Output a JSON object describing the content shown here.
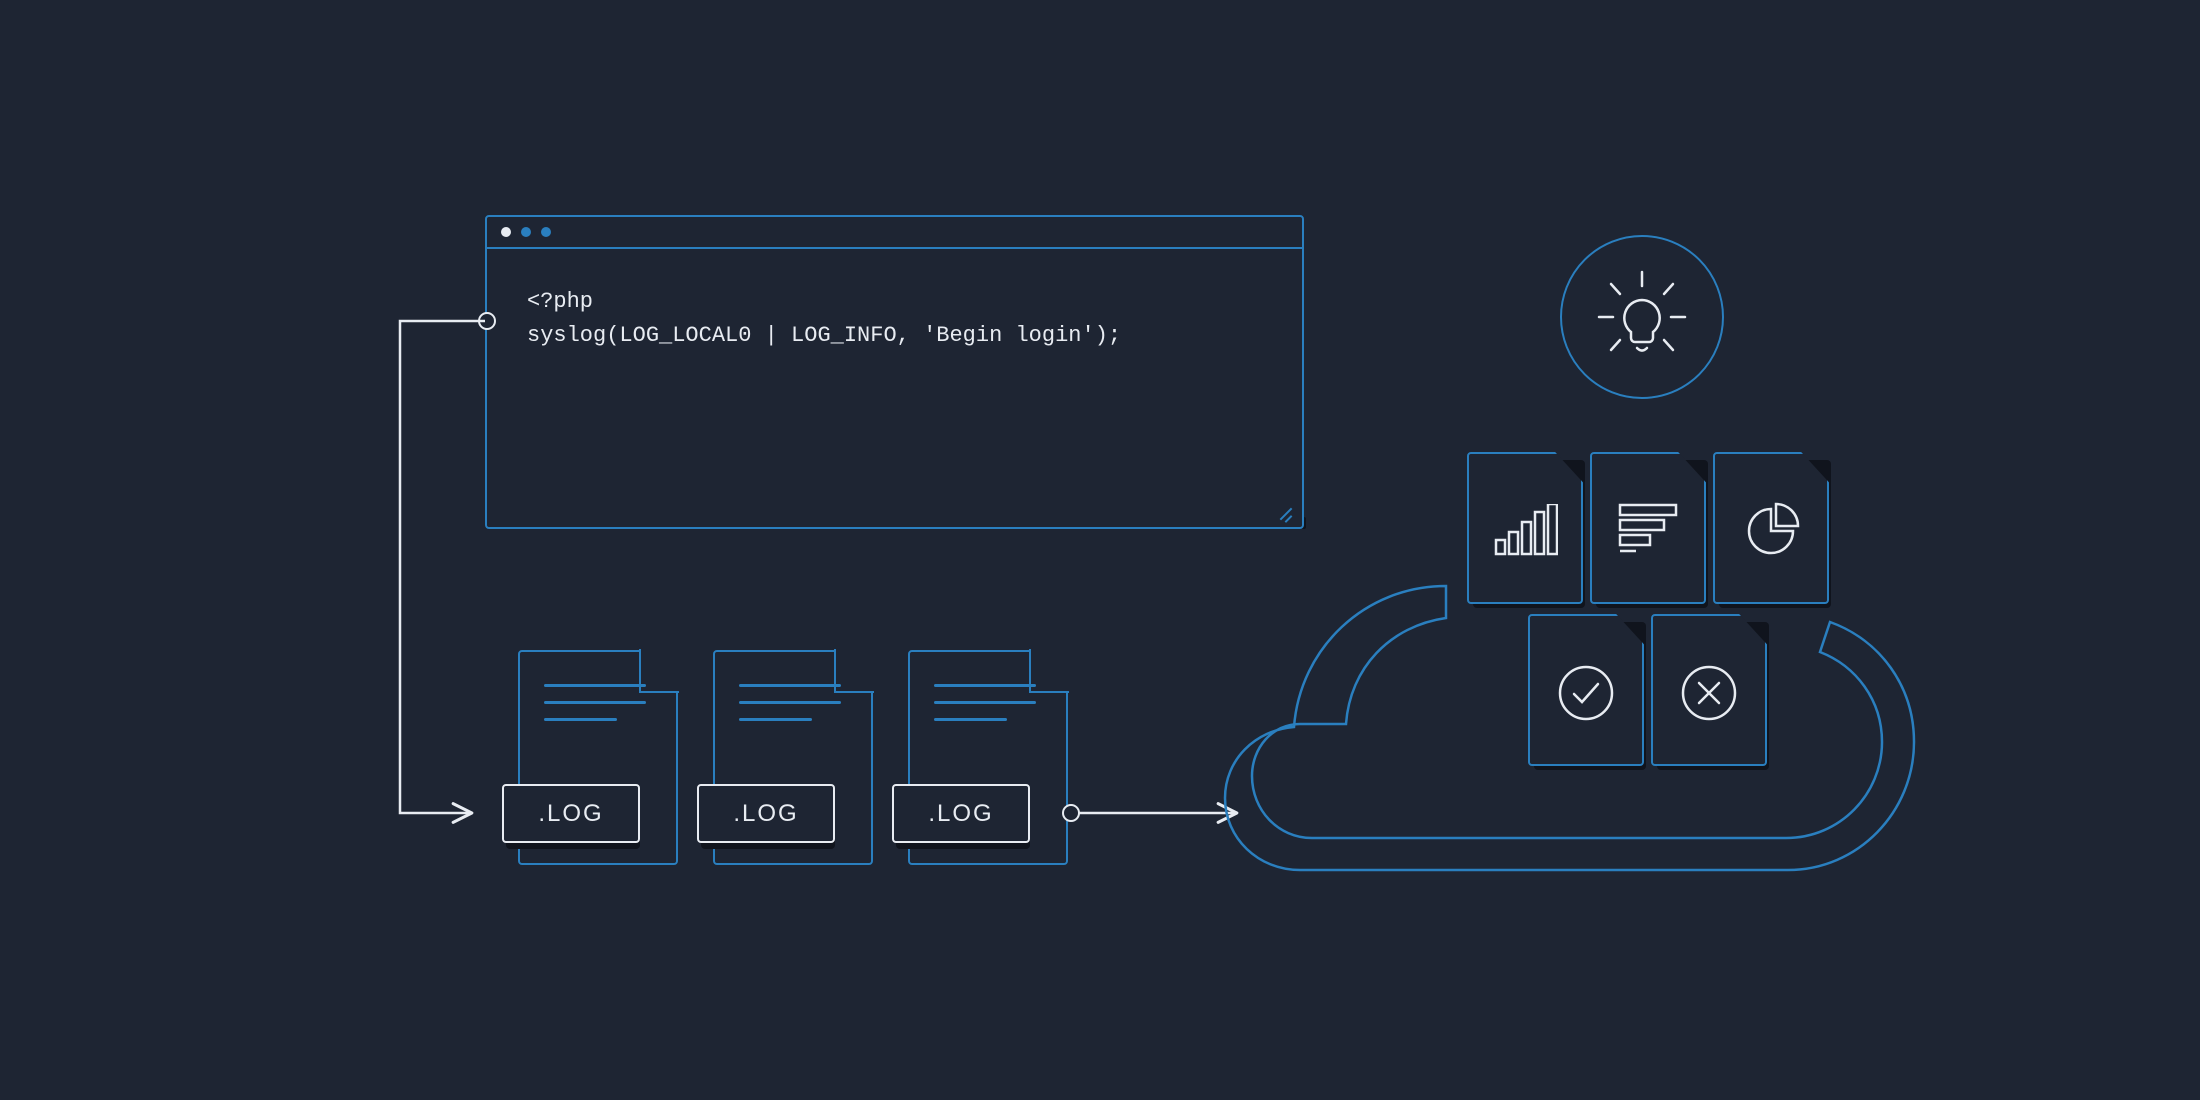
{
  "code": {
    "line1": "<?php",
    "line2": "syslog(LOG_LOCAL0 | LOG_INFO, 'Begin login');"
  },
  "logs": {
    "label1": ".LOG",
    "label2": ".LOG",
    "label3": ".LOG"
  },
  "icons": {
    "window_dots": [
      "white",
      "blue",
      "blue"
    ],
    "insight": "lightbulb-icon",
    "reports": [
      "bar-chart-icon",
      "horizontal-bars-icon",
      "pie-chart-icon",
      "check-circle-icon",
      "x-circle-icon"
    ]
  },
  "colors": {
    "bg": "#1e2533",
    "stroke_blue": "#2a7fbf",
    "stroke_white": "#e8ecf2",
    "shadow": "#10141d"
  }
}
